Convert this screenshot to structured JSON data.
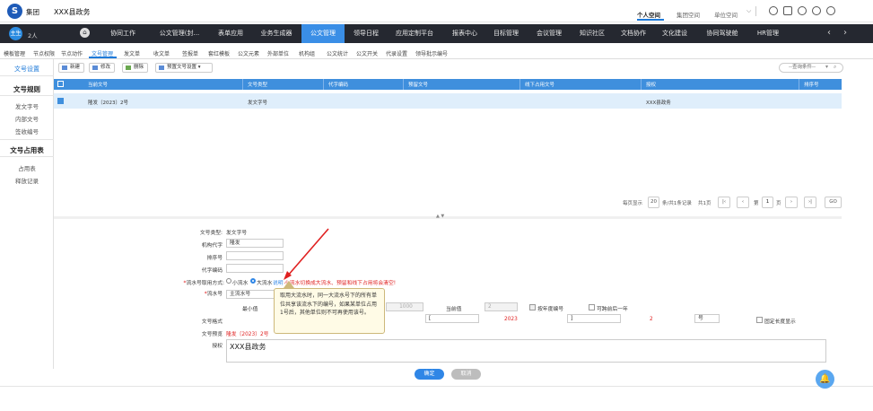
{
  "header": {
    "org": "集团",
    "site": "XXX县政务",
    "personal": "个人空间",
    "group_space": "集团空间",
    "unit_space": "单位空间"
  },
  "nav": {
    "user_count": "2人",
    "avatar_text": "主生",
    "items": [
      "协同工作",
      "公文管理(封...",
      "表单应用",
      "业务生成器",
      "公文管理",
      "领导日程",
      "应用定制平台",
      "报表中心",
      "目标管理",
      "会议管理",
      "知识社区",
      "文档协作",
      "文化建设",
      "协同驾驶舱",
      "HR管理"
    ],
    "active_index": 4
  },
  "subnav": {
    "items": [
      "模板管理",
      "节点权限",
      "节点动作",
      "文号管理",
      "发文单",
      "收文单",
      "签报单",
      "套红模板",
      "公文元素",
      "外部单位",
      "机构组",
      "公文统计",
      "公文开关",
      "代录设置",
      "领导批示编号"
    ],
    "active_index": 3
  },
  "sidebar": {
    "title": "文号设置",
    "section1": "文号规则",
    "items1": [
      "发文字号",
      "内部文号",
      "签收编号"
    ],
    "section2": "文号占用表",
    "items2": [
      "占用表",
      "释放记录"
    ]
  },
  "toolbar": {
    "new": "新建",
    "edit": "修改",
    "delete": "删除",
    "preset": "预置文号设置 ▾",
    "search_placeholder": "--查询条件--"
  },
  "table": {
    "headers": [
      "当前文号",
      "文号类型",
      "代字编码",
      "预留文号",
      "线下占用文号",
      "授权",
      "排序号"
    ],
    "rows": [
      [
        "隆发〔2023〕2号",
        "发文字号",
        "",
        "",
        "",
        "XXX县政务",
        ""
      ]
    ]
  },
  "pagination": {
    "prefix": "每页显示",
    "per_page": "20",
    "info": "条/共1条记录",
    "pages": "共1页",
    "current": "1",
    "page_unit": "页",
    "go": "GO"
  },
  "form": {
    "doc_type_label": "文号类型:",
    "doc_type": "发文字号",
    "agency_label": "机构代字",
    "agency": "隆发",
    "sort_label": "排序号",
    "sort": "",
    "code_label": "代字编码",
    "code": "",
    "serial_label": "流水号取用方式:",
    "small": "小流水",
    "big": "大流水",
    "explain": "说明",
    "warn": "小流水切换成大流水、预留和线下占用将会清空!",
    "serialno_label": "流水号",
    "serialno": "主流水号",
    "min_label": "最小值",
    "min_val": "1000",
    "cur_label": "当前值",
    "cur_val": "2",
    "yearly": "按年度编号",
    "cross_year": "可跨前后一年",
    "format_label": "文号格式",
    "fmt_open": "[",
    "fmt_year": "2023",
    "fmt_close": "]",
    "fmt_num": "2",
    "fmt_unit": "号",
    "fixed_len": "固定长度显示",
    "preview_label": "文号预览",
    "preview": "隆发〔2023〕2号",
    "auth_label": "授权",
    "auth": "XXX县政务",
    "confirm": "确定",
    "cancel": "取消"
  },
  "tooltip": "取用大流水时，同一大流水号下的所有单位共享该流水下的编号，如果某单位占用1号后，其他单位则不可再使用该号。"
}
